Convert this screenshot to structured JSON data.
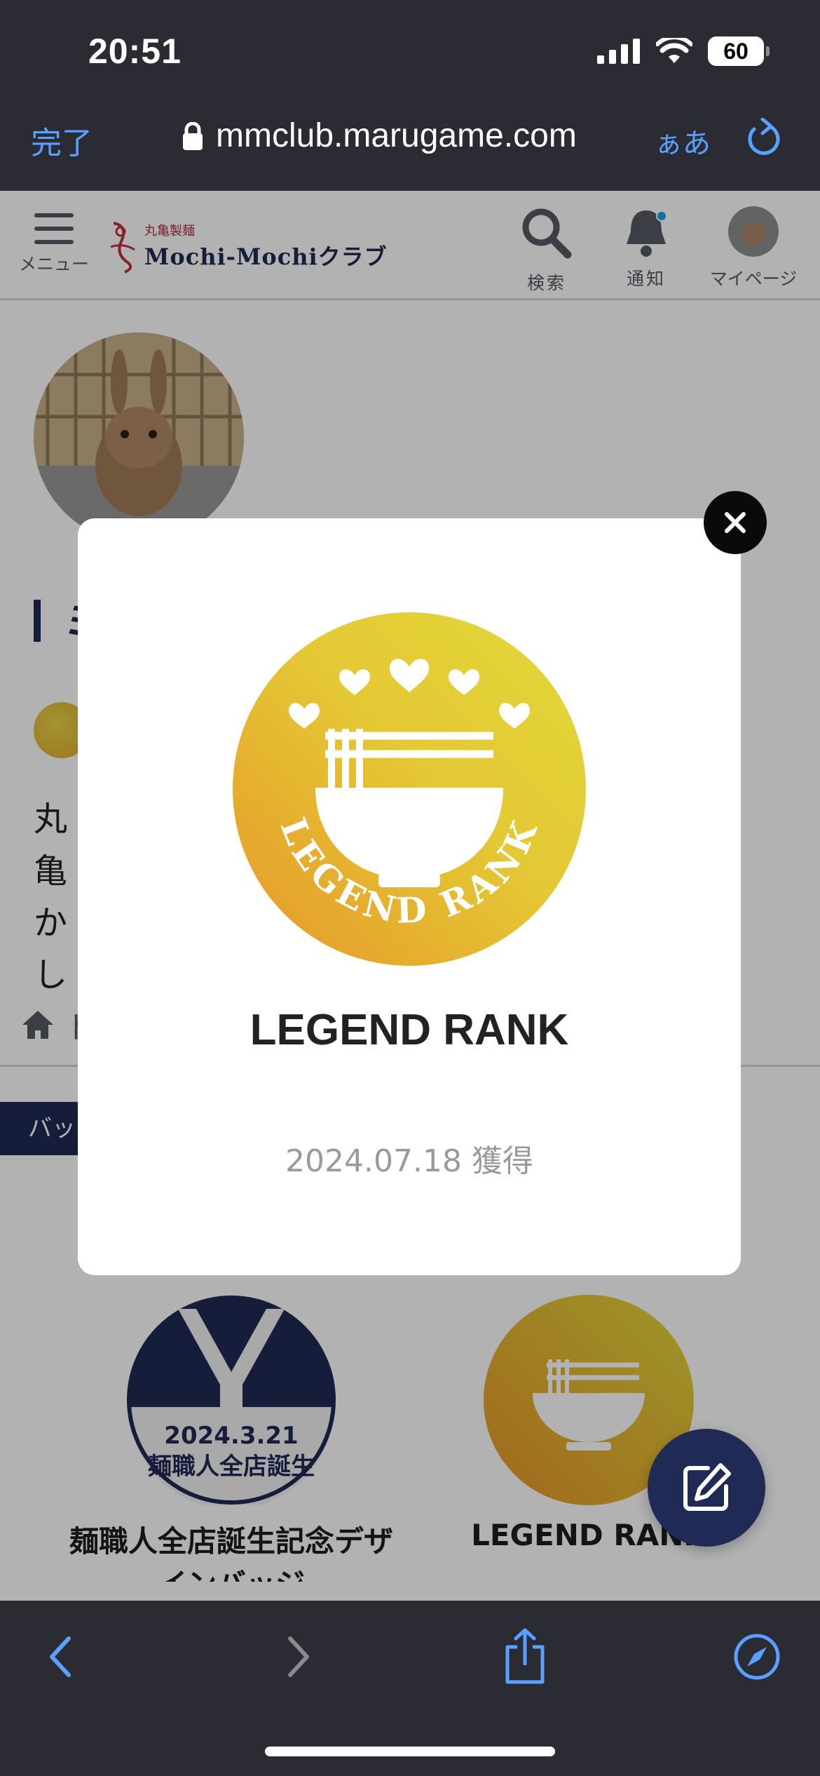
{
  "status_bar": {
    "time": "20:51",
    "battery": "60"
  },
  "browser": {
    "done_label": "完了",
    "url": "mmclub.marugame.com",
    "text_size_label": "ぁあ"
  },
  "header": {
    "menu_label": "メニュー",
    "logo_small": "丸亀製麺",
    "logo_main": "Mochi-Mochiクラブ",
    "search_label": "検索",
    "notify_label": "通知",
    "mypage_label": "マイページ"
  },
  "page": {
    "title_fragment": "ミ",
    "post_text_lines": [
      "丸亀",
      "かし"
    ],
    "breadcrumb_home": "ト",
    "badge_tab_label": "バッジ"
  },
  "badges": [
    {
      "name_line1": "麺職人全店誕生記念デザ",
      "name_line2": "インバッジ",
      "stamp_date": "2024.3.21",
      "stamp_text": "麺職人全店誕生"
    },
    {
      "name_line1": "LEGEND RANK"
    }
  ],
  "modal": {
    "badge_ring_text": "LEGEND RANK",
    "title": "LEGEND RANK",
    "acquired": "2024.07.18 獲得"
  },
  "colors": {
    "navy": "#1f2a55",
    "gold_start": "#e8962a",
    "gold_end": "#e2d83a",
    "link_blue": "#5aa1ff"
  },
  "icons": [
    "lock-icon",
    "reload-icon",
    "menu-icon",
    "search-icon",
    "bell-icon",
    "home-icon",
    "close-icon",
    "edit-icon",
    "back-icon",
    "forward-icon",
    "share-icon",
    "compass-icon"
  ]
}
